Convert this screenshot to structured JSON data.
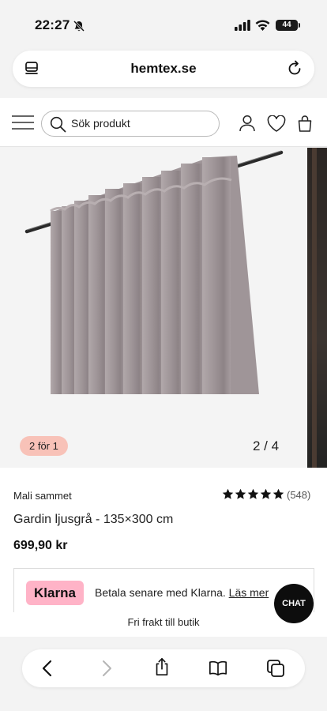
{
  "status_bar": {
    "time": "22:27",
    "battery": "44"
  },
  "browser": {
    "url": "hemtex.se"
  },
  "header": {
    "search_placeholder": "Sök produkt"
  },
  "gallery": {
    "badge": "2 för 1",
    "counter": "2 / 4"
  },
  "product": {
    "collection": "Mali sammet",
    "rating": 5,
    "review_count": "(548)",
    "title": "Gardin ljusgrå - 135×300 cm",
    "price": "699,90 kr"
  },
  "klarna": {
    "logo": "Klarna",
    "text": "Betala senare med Klarna.",
    "link": "Läs mer"
  },
  "shipping": "Fri frakt till butik",
  "chat_label": "CHAT",
  "colors": {
    "badge": "#f8c2b8",
    "klarna": "#ffb3c7",
    "curtain": "#a49a9c"
  }
}
